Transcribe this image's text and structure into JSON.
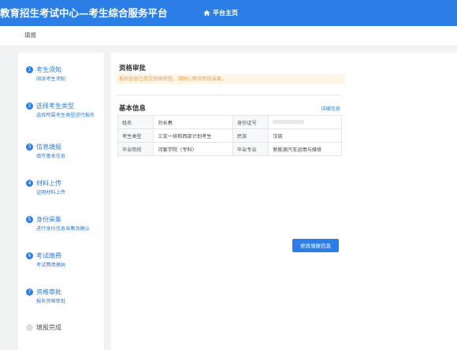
{
  "topbar": {
    "title": "教育招生考试中心—考生综合服务平台",
    "home_label": "平台主页",
    "home_icon": "home-icon"
  },
  "subbar": {
    "breadcrumb": "填报"
  },
  "steps": [
    {
      "num": "1",
      "name": "考生须知",
      "desc": "阅读考生须知"
    },
    {
      "num": "2",
      "name": "选择考生类型",
      "desc": "选择所属考生类型进行报名"
    },
    {
      "num": "3",
      "name": "信息填报",
      "desc": "填写基本信息"
    },
    {
      "num": "4",
      "name": "材料上传",
      "desc": "证明材料上传"
    },
    {
      "num": "5",
      "name": "身份采集",
      "desc": "进行身份信息采集及确认"
    },
    {
      "num": "6",
      "name": "考试缴费",
      "desc": "考试费用缴纳"
    },
    {
      "num": "7",
      "name": "资格审批",
      "desc": "报名资格审批"
    },
    {
      "num": "",
      "name": "填报完成",
      "desc": ""
    }
  ],
  "main": {
    "section_title": "资格审批",
    "notice": "报名信息已提交资格审批，请耐心等待审批结果。",
    "basic_title": "基本信息",
    "detail_link": "详细信息",
    "table": [
      [
        "姓名",
        "刘长春",
        "身份证号",
        ""
      ],
      [
        "考生类型",
        "三支一扶和西部计划考生",
        "民族",
        "汉族"
      ],
      [
        "毕业院校",
        "河套学院（专科）",
        "毕业专业",
        "新能源汽车运用与维修"
      ]
    ],
    "edit_button": "修改填报信息"
  },
  "colors": {
    "accent": "#2b7ee6",
    "notice_bg": "#fdf5e6",
    "notice_text": "#f0a04a"
  }
}
